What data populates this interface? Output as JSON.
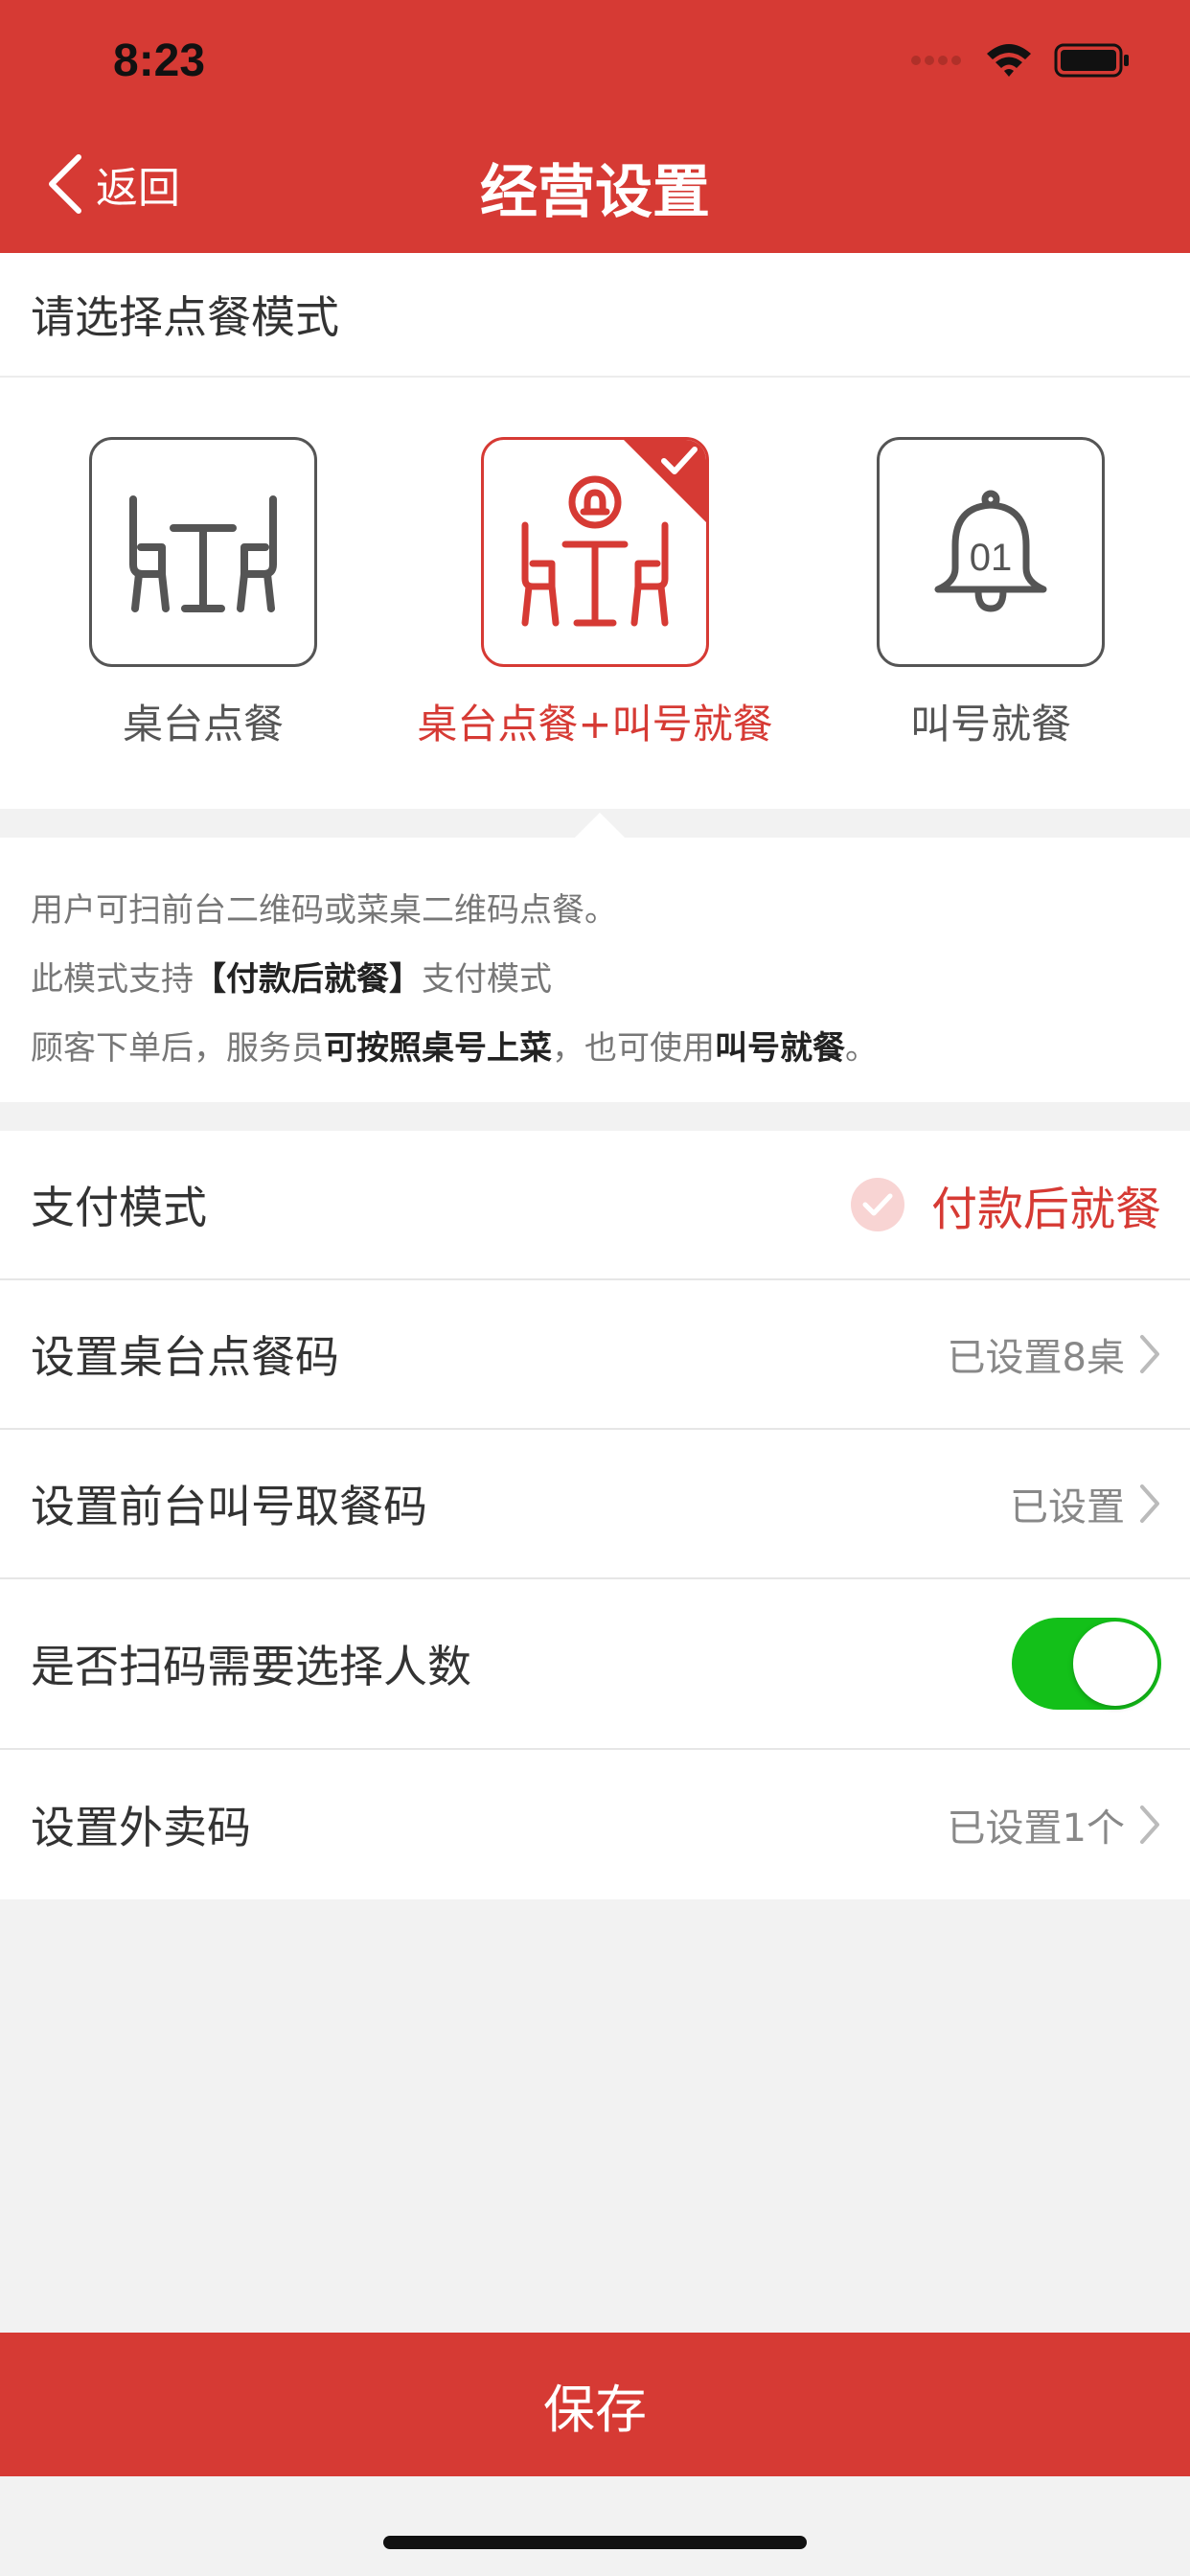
{
  "status": {
    "time": "8:23"
  },
  "nav": {
    "back_label": "返回",
    "title": "经营设置"
  },
  "section": {
    "title": "请选择点餐模式"
  },
  "modes": [
    {
      "label": "桌台点餐",
      "selected": false,
      "icon": "table-chairs-icon"
    },
    {
      "label": "桌台点餐+叫号就餐",
      "selected": true,
      "icon": "table-bell-icon"
    },
    {
      "label": "叫号就餐",
      "selected": false,
      "icon": "bell-number-icon",
      "icon_text": "01"
    }
  ],
  "description": {
    "line1": "用户可扫前台二维码或菜桌二维码点餐。",
    "line2_a": "此模式支持",
    "line2_b": "【付款后就餐】",
    "line2_c": "支付模式",
    "line3_a": "顾客下单后，服务员",
    "line3_b": "可按照桌号上菜",
    "line3_c": "，也可使用",
    "line3_d": "叫号就餐",
    "line3_e": "。"
  },
  "settings": {
    "payment": {
      "label": "支付模式",
      "value": "付款后就餐"
    },
    "table_code": {
      "label": "设置桌台点餐码",
      "value": "已设置8桌"
    },
    "counter_code": {
      "label": "设置前台叫号取餐码",
      "value": "已设置"
    },
    "people_count": {
      "label": "是否扫码需要选择人数",
      "enabled": true
    },
    "takeout_code": {
      "label": "设置外卖码",
      "value": "已设置1个"
    }
  },
  "save": {
    "label": "保存"
  },
  "colors": {
    "accent": "#d63a34",
    "toggle_on": "#13c019"
  }
}
